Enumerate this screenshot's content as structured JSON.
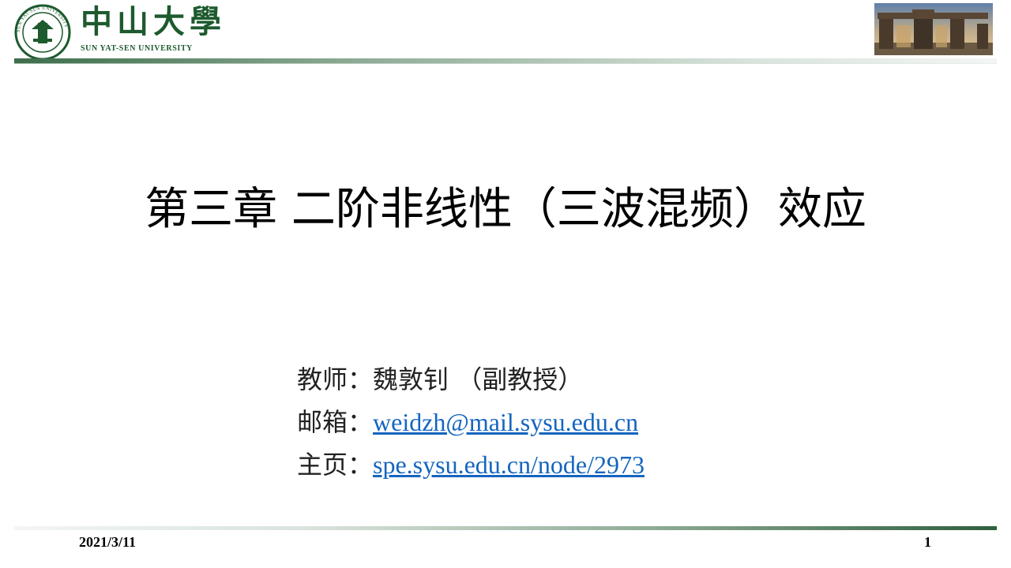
{
  "header": {
    "logo_cn": "中山大學",
    "logo_en": "SUN YAT-SEN UNIVERSITY",
    "seal_text": "SUN YAT-SEN UNIVERSITY",
    "seal_icon": "university-seal-icon",
    "photo_icon": "campus-gate-photo",
    "brand_color": "#1d5a2e"
  },
  "slide": {
    "title": "第三章  二阶非线性（三波混频）效应"
  },
  "info": {
    "teacher_label": "教师：",
    "teacher_value": "魏敦钊 （副教授）",
    "email_label": "邮箱：",
    "email_value": "weidzh@mail.sysu.edu.cn",
    "homepage_label": "主页：",
    "homepage_value": "spe.sysu.edu.cn/node/2973",
    "link_color": "#1565c0"
  },
  "footer": {
    "date": "2021/3/11",
    "page_number": "1"
  }
}
